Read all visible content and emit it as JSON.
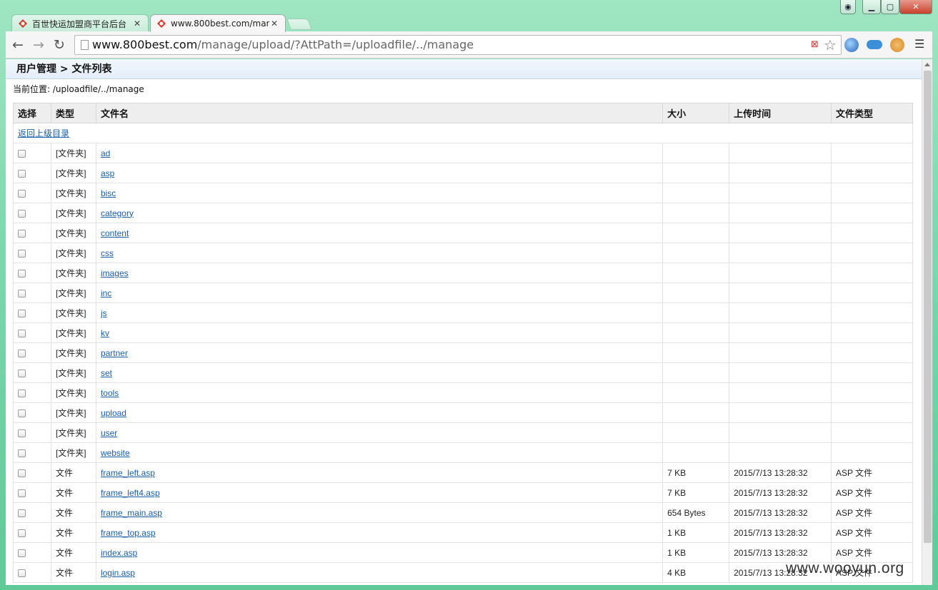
{
  "tabs": [
    {
      "title": "百世快运加盟商平台后台",
      "active": false
    },
    {
      "title": "www.800best.com/man",
      "active": true
    }
  ],
  "toolbar": {
    "url_host": "www.800best.com",
    "url_path": "/manage/upload/?AttPath=/uploadfile/../manage"
  },
  "page": {
    "heading": "用户管理 > 文件列表",
    "location_label": "当前位置:",
    "location_value": "/uploadfile/../manage"
  },
  "table": {
    "headers": [
      "选择",
      "类型",
      "文件名",
      "大小",
      "上传时间",
      "文件类型"
    ],
    "parent_link": "返回上级目录",
    "rows": [
      {
        "type": "[文件夹]",
        "name": "ad",
        "size": "",
        "time": "",
        "ftype": ""
      },
      {
        "type": "[文件夹]",
        "name": "asp",
        "size": "",
        "time": "",
        "ftype": ""
      },
      {
        "type": "[文件夹]",
        "name": "bisc",
        "size": "",
        "time": "",
        "ftype": ""
      },
      {
        "type": "[文件夹]",
        "name": "category",
        "size": "",
        "time": "",
        "ftype": ""
      },
      {
        "type": "[文件夹]",
        "name": "content",
        "size": "",
        "time": "",
        "ftype": ""
      },
      {
        "type": "[文件夹]",
        "name": "css",
        "size": "",
        "time": "",
        "ftype": ""
      },
      {
        "type": "[文件夹]",
        "name": "images",
        "size": "",
        "time": "",
        "ftype": ""
      },
      {
        "type": "[文件夹]",
        "name": "inc",
        "size": "",
        "time": "",
        "ftype": ""
      },
      {
        "type": "[文件夹]",
        "name": "js",
        "size": "",
        "time": "",
        "ftype": ""
      },
      {
        "type": "[文件夹]",
        "name": "kv",
        "size": "",
        "time": "",
        "ftype": ""
      },
      {
        "type": "[文件夹]",
        "name": "partner",
        "size": "",
        "time": "",
        "ftype": ""
      },
      {
        "type": "[文件夹]",
        "name": "set",
        "size": "",
        "time": "",
        "ftype": ""
      },
      {
        "type": "[文件夹]",
        "name": "tools",
        "size": "",
        "time": "",
        "ftype": ""
      },
      {
        "type": "[文件夹]",
        "name": "upload",
        "size": "",
        "time": "",
        "ftype": ""
      },
      {
        "type": "[文件夹]",
        "name": "user",
        "size": "",
        "time": "",
        "ftype": ""
      },
      {
        "type": "[文件夹]",
        "name": "website",
        "size": "",
        "time": "",
        "ftype": ""
      },
      {
        "type": "文件",
        "name": "frame_left.asp",
        "size": "7 KB",
        "time": "2015/7/13 13:28:32",
        "ftype": "ASP 文件"
      },
      {
        "type": "文件",
        "name": "frame_left4.asp",
        "size": "7 KB",
        "time": "2015/7/13 13:28:32",
        "ftype": "ASP 文件"
      },
      {
        "type": "文件",
        "name": "frame_main.asp",
        "size": "654 Bytes",
        "time": "2015/7/13 13:28:32",
        "ftype": "ASP 文件"
      },
      {
        "type": "文件",
        "name": "frame_top.asp",
        "size": "1 KB",
        "time": "2015/7/13 13:28:32",
        "ftype": "ASP 文件"
      },
      {
        "type": "文件",
        "name": "index.asp",
        "size": "1 KB",
        "time": "2015/7/13 13:28:32",
        "ftype": "ASP 文件"
      },
      {
        "type": "文件",
        "name": "login.asp",
        "size": "4 KB",
        "time": "2015/7/13 13:28:32",
        "ftype": "ASP 文件"
      }
    ]
  },
  "watermark": "www.wooyun.org",
  "icons": {
    "favicon": "800best-logo-icon",
    "back": "arrow-left-icon",
    "forward": "arrow-right-icon",
    "reload": "reload-icon",
    "bookmark": "star-icon"
  }
}
